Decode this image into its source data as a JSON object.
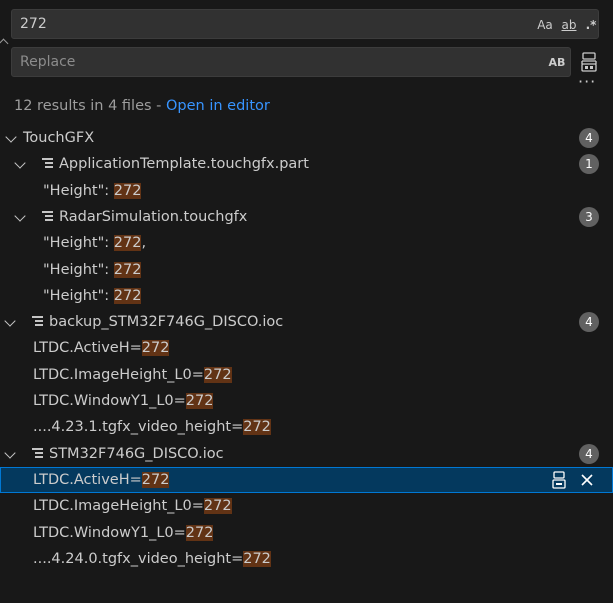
{
  "search": {
    "find_value": "272",
    "replace_placeholder": "Replace"
  },
  "options": {
    "match_case": "Aa",
    "whole_word": "ab",
    "regex": ".*",
    "preserve_case": "AB"
  },
  "summary": {
    "text": "12 results in 4 files - ",
    "link": "Open in editor"
  },
  "tree": [
    {
      "kind": "folder",
      "label": "TouchGFX",
      "count": "4"
    },
    {
      "kind": "file",
      "indent": 1,
      "label": "ApplicationTemplate.touchgfx.part",
      "count": "1"
    },
    {
      "kind": "match",
      "indent": 1,
      "pre": "\"Height\": ",
      "hit": "272",
      "post": ""
    },
    {
      "kind": "file",
      "indent": 1,
      "label": "RadarSimulation.touchgfx",
      "count": "3"
    },
    {
      "kind": "match",
      "indent": 1,
      "pre": "\"Height\": ",
      "hit": "272",
      "post": ","
    },
    {
      "kind": "match",
      "indent": 1,
      "pre": "\"Height\": ",
      "hit": "272",
      "post": ""
    },
    {
      "kind": "match",
      "indent": 1,
      "pre": "\"Height\": ",
      "hit": "272",
      "post": ""
    },
    {
      "kind": "file",
      "indent": 0,
      "label": "backup_STM32F746G_DISCO.ioc",
      "count": "4"
    },
    {
      "kind": "match",
      "indent": 0,
      "pre": "LTDC.ActiveH=",
      "hit": "272",
      "post": ""
    },
    {
      "kind": "match",
      "indent": 0,
      "pre": "LTDC.ImageHeight_L0=",
      "hit": "272",
      "post": ""
    },
    {
      "kind": "match",
      "indent": 0,
      "pre": "LTDC.WindowY1_L0=",
      "hit": "272",
      "post": ""
    },
    {
      "kind": "match",
      "indent": 0,
      "pre": "....4.23.1.tgfx_video_height=",
      "hit": "272",
      "post": ""
    },
    {
      "kind": "file",
      "indent": 0,
      "label": "STM32F746G_DISCO.ioc",
      "count": "4"
    },
    {
      "kind": "match",
      "indent": 0,
      "pre": "LTDC.ActiveH=",
      "hit": "272",
      "post": "",
      "selected": true
    },
    {
      "kind": "match",
      "indent": 0,
      "pre": "LTDC.ImageHeight_L0=",
      "hit": "272",
      "post": ""
    },
    {
      "kind": "match",
      "indent": 0,
      "pre": "LTDC.WindowY1_L0=",
      "hit": "272",
      "post": ""
    },
    {
      "kind": "match",
      "indent": 0,
      "pre": "....4.24.0.tgfx_video_height=",
      "hit": "272",
      "post": ""
    }
  ]
}
